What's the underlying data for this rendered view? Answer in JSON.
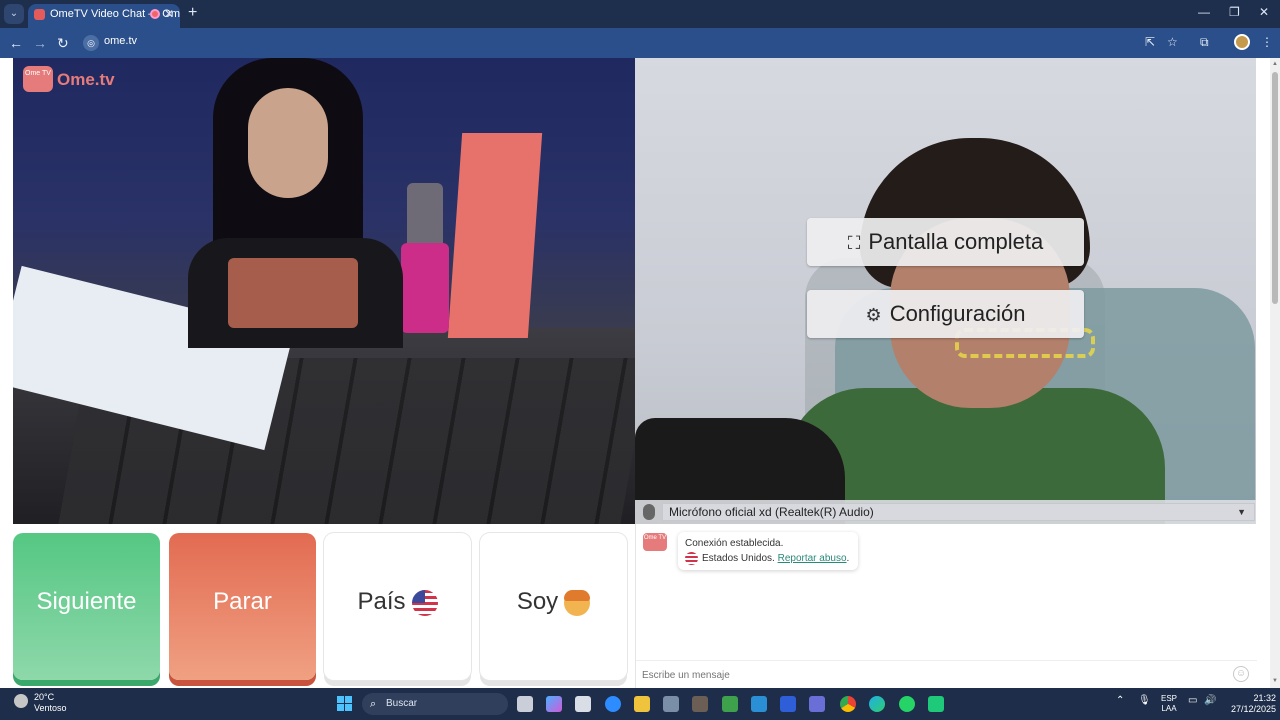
{
  "browser": {
    "tab_title": "OmeTV Video Chat — Ome",
    "url": "ome.tv"
  },
  "logo": {
    "brand": "Ome.tv",
    "badge": "Ome TV"
  },
  "remote_video": {
    "fullscreen_label": "Pantalla completa",
    "settings_label": "Configuración"
  },
  "microphone": {
    "selected": "Micrófono oficial xd (Realtek(R) Audio)"
  },
  "controls": {
    "next_label": "Siguiente",
    "stop_label": "Parar",
    "country_label": "País",
    "me_label": "Soy"
  },
  "chat": {
    "logo_text": "Ome TV",
    "status": "Conexión establecida.",
    "country": "Estados Unidos.",
    "report_link": "Reportar abuso",
    "report_punct": ".",
    "input_placeholder": "Escribe un mensaje"
  },
  "taskbar": {
    "weather_temp": "20°C",
    "weather_desc": "Ventoso",
    "search_placeholder": "Buscar",
    "lang": "ESP",
    "layout": "LAA",
    "time": "21:32",
    "date": "27/12/2025"
  },
  "colors": {
    "next": "#55c783",
    "stop": "#e26b52",
    "brand": "#e57b7b",
    "link": "#2a8a7a"
  }
}
